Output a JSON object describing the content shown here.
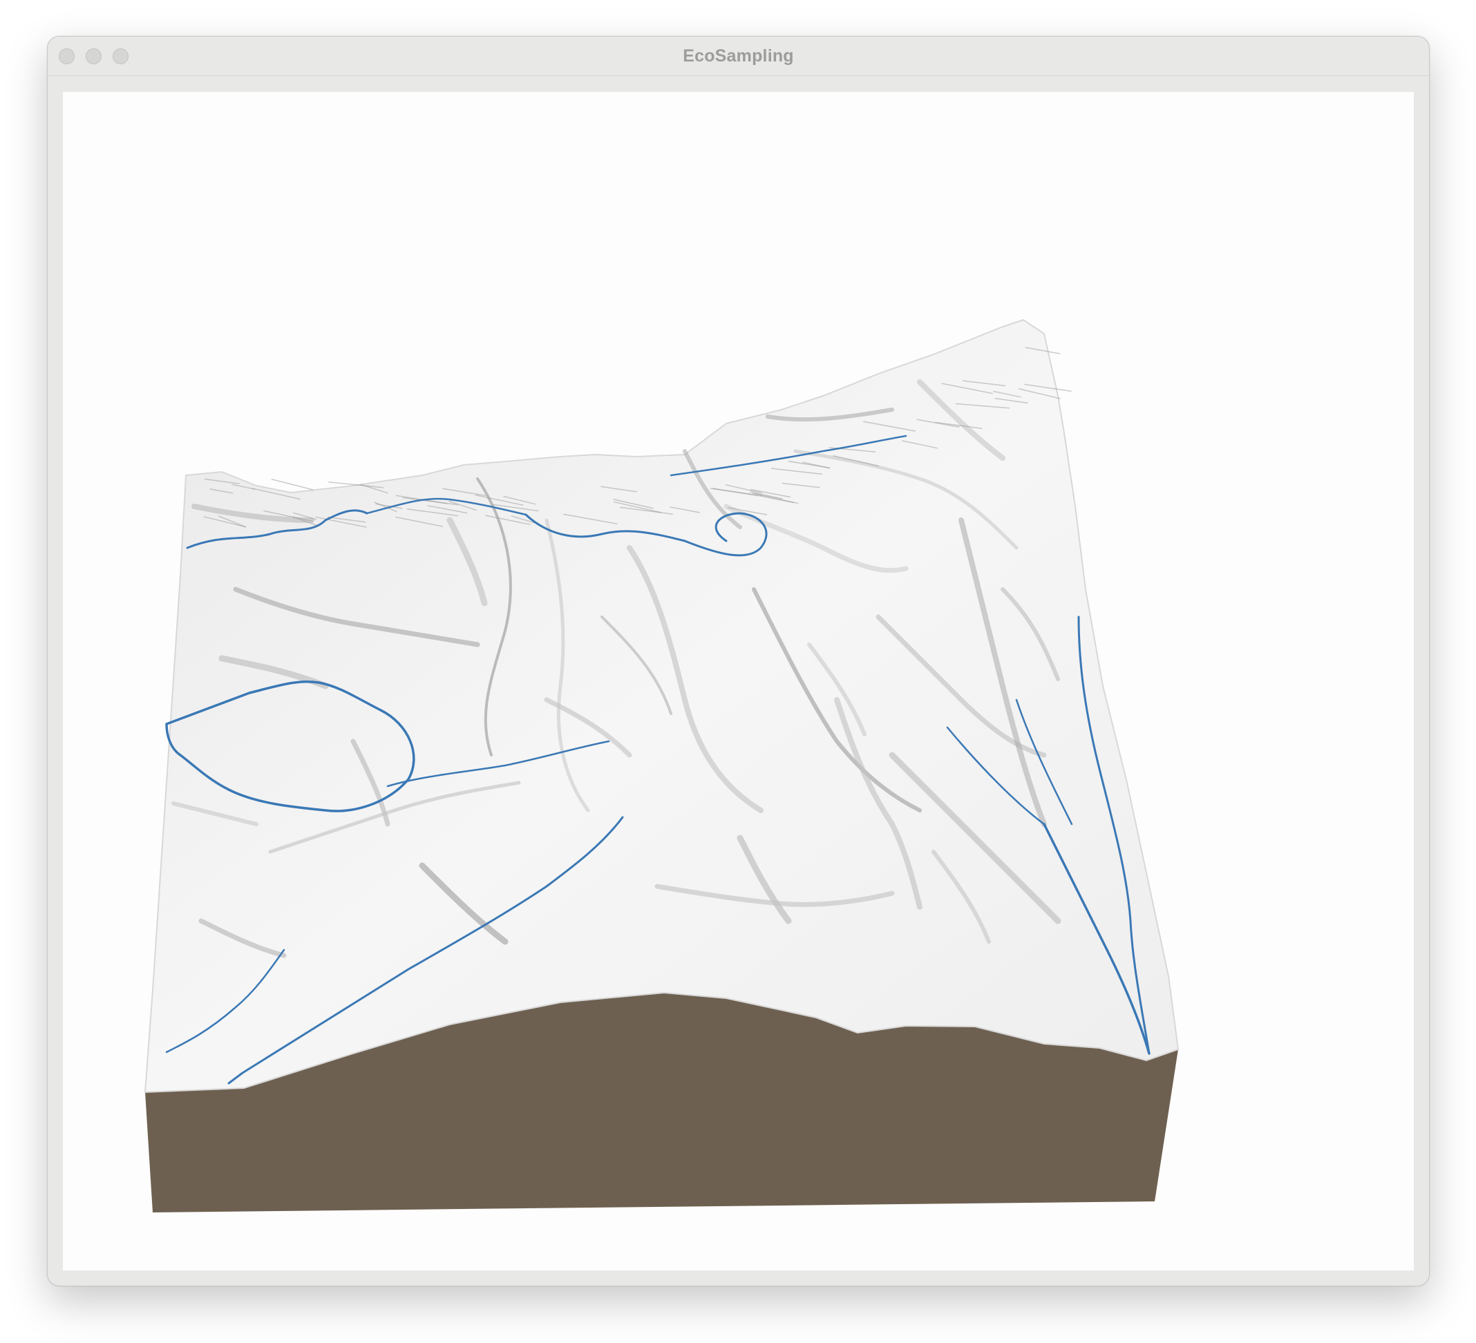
{
  "window": {
    "title": "EcoSampling"
  },
  "titlebar": {
    "buttons": [
      "close-button",
      "minimize-button",
      "zoom-button"
    ]
  },
  "viewport": {
    "content": "3d-terrain-render",
    "colors": {
      "background": "#fdfdfd",
      "terrain_surface": "#f2f2f2",
      "terrain_shade": "#b9b9b9",
      "soil_side": "#6e6050",
      "river": "#3a78b5"
    }
  }
}
